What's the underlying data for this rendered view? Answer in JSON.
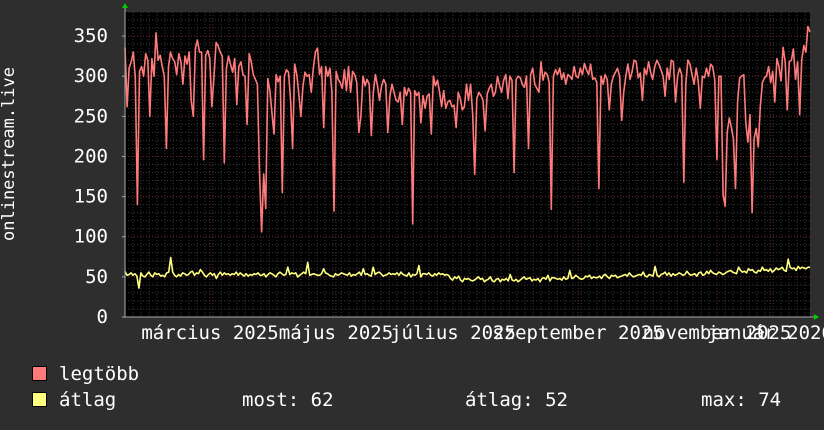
{
  "chart_data": {
    "type": "line",
    "ylabel": "onlinestream.live",
    "ylim": [
      0,
      380
    ],
    "yticks": [
      0,
      50,
      100,
      150,
      200,
      250,
      300,
      350
    ],
    "x_tick_labels": [
      "március 2025",
      "május 2025",
      "július 2025",
      "szeptember 2025",
      "november 2025",
      "január 2026"
    ],
    "grid": true,
    "series": [
      {
        "name": "legtöbb",
        "color": "#ff7b7b",
        "values": [
          336,
          262,
          310,
          318,
          330,
          298,
          140,
          306,
          312,
          300,
          328,
          320,
          250,
          322,
          300,
          354,
          320,
          326,
          312,
          300,
          210,
          312,
          330,
          322,
          318,
          302,
          328,
          318,
          290,
          325,
          315,
          330,
          270,
          250,
          335,
          345,
          330,
          330,
          196,
          326,
          332,
          322,
          262,
          300,
          342,
          338,
          330,
          325,
          192,
          310,
          325,
          315,
          305,
          322,
          265,
          312,
          318,
          302,
          300,
          240,
          328,
          318,
          302,
          296,
          290,
          180,
          106,
          178,
          135,
          297,
          282,
          255,
          228,
          302,
          293,
          300,
          155,
          300,
          308,
          305,
          270,
          210,
          315,
          302,
          278,
          250,
          288,
          305,
          300,
          302,
          280,
          310,
          330,
          335,
          302,
          312,
          236,
          312,
          300,
          310,
          280,
          132,
          306,
          296,
          292,
          285,
          308,
          282,
          312,
          280,
          306,
          302,
          292,
          230,
          250,
          300,
          288,
          296,
          290,
          226,
          280,
          302,
          288,
          270,
          288,
          296,
          290,
          230,
          275,
          290,
          280,
          270,
          268,
          280,
          240,
          286,
          276,
          285,
          280,
          116,
          282,
          276,
          280,
          242,
          276,
          260,
          275,
          278,
          228,
          300,
          288,
          295,
          280,
          262,
          282,
          260,
          268,
          270,
          262,
          264,
          236,
          280,
          272,
          258,
          262,
          290,
          270,
          290,
          252,
          178,
          272,
          280,
          276,
          270,
          232,
          278,
          285,
          290,
          275,
          280,
          300,
          288,
          280,
          295,
          302,
          272,
          300,
          295,
          180,
          296,
          300,
          298,
          290,
          286,
          300,
          210,
          302,
          310,
          290,
          285,
          280,
          318,
          295,
          305,
          302,
          292,
          134,
          300,
          308,
          302,
          310,
          296,
          304,
          290,
          302,
          300,
          296,
          312,
          300,
          298,
          310,
          302,
          316,
          308,
          302,
          315,
          296,
          298,
          292,
          160,
          300,
          290,
          302,
          296,
          258,
          290,
          300,
          305,
          310,
          300,
          245,
          280,
          300,
          315,
          296,
          305,
          320,
          318,
          298,
          304,
          270,
          310,
          302,
          318,
          305,
          296,
          312,
          320,
          315,
          308,
          300,
          275,
          310,
          296,
          320,
          318,
          268,
          300,
          310,
          302,
          168,
          290,
          320,
          315,
          302,
          290,
          310,
          294,
          260,
          300,
          298,
          310,
          300,
          315,
          312,
          295,
          196,
          300,
          300,
          152,
          138,
          230,
          248,
          236,
          222,
          160,
          268,
          298,
          300,
          302,
          242,
          218,
          252,
          130,
          222,
          235,
          212,
          262,
          292,
          298,
          300,
          312,
          292,
          306,
          268,
          322,
          312,
          294,
          336,
          318,
          258,
          318,
          320,
          334,
          296,
          318,
          252,
          320,
          338,
          330,
          362,
          355
        ]
      },
      {
        "name": "átlag",
        "color": "#ffff80",
        "values": [
          57,
          52,
          53,
          55,
          52,
          54,
          51,
          36,
          55,
          51,
          50,
          53,
          56,
          52,
          50,
          55,
          53,
          54,
          51,
          52,
          50,
          55,
          56,
          74,
          56,
          52,
          50,
          53,
          51,
          55,
          54,
          52,
          53,
          56,
          57,
          52,
          55,
          54,
          59,
          56,
          52,
          50,
          53,
          55,
          52,
          54,
          48,
          53,
          56,
          52,
          55,
          53,
          54,
          52,
          54,
          53,
          56,
          52,
          55,
          53,
          51,
          54,
          51,
          53,
          52,
          54,
          53,
          55,
          52,
          52,
          54,
          50,
          53,
          55,
          54,
          52,
          50,
          54,
          56,
          54,
          52,
          53,
          62,
          53,
          55,
          54,
          55,
          50,
          52,
          54,
          56,
          54,
          68,
          52,
          53,
          54,
          53,
          52,
          52,
          54,
          60,
          55,
          54,
          52,
          51,
          50,
          54,
          52,
          53,
          55,
          54,
          53,
          52,
          55,
          51,
          53,
          52,
          54,
          56,
          52,
          60,
          53,
          54,
          52,
          51,
          62,
          53,
          55,
          56,
          54,
          51,
          52,
          53,
          55,
          53,
          54,
          53,
          55,
          52,
          56,
          53,
          52,
          51,
          55,
          50,
          53,
          52,
          54,
          64,
          50,
          54,
          54,
          53,
          55,
          52,
          51,
          54,
          52,
          55,
          53,
          54,
          52,
          53,
          52,
          48,
          46,
          50,
          48,
          51,
          46,
          44,
          48,
          47,
          48,
          46,
          45,
          46,
          48,
          50,
          47,
          48,
          44,
          46,
          47,
          50,
          45,
          44,
          47,
          48,
          44,
          47,
          46,
          48,
          45,
          53,
          46,
          45,
          47,
          44,
          46,
          48,
          50,
          47,
          48,
          49,
          45,
          47,
          46,
          48,
          44,
          48,
          49,
          47,
          52,
          45,
          49,
          49,
          48,
          47,
          48,
          46,
          50,
          47,
          48,
          58,
          48,
          49,
          52,
          50,
          48,
          47,
          48,
          51,
          50,
          52,
          48,
          50,
          49,
          49,
          51,
          48,
          52,
          53,
          50,
          48,
          52,
          51,
          52,
          49,
          50,
          51,
          52,
          53,
          51,
          55,
          52,
          50,
          51,
          52,
          53,
          52,
          56,
          51,
          50,
          53,
          52,
          51,
          63,
          52,
          50,
          53,
          54,
          56,
          52,
          55,
          51,
          54,
          52,
          53,
          55,
          54,
          52,
          53,
          57,
          54,
          52,
          53,
          54,
          51,
          55,
          56,
          52,
          53,
          57,
          54,
          58,
          55,
          54,
          53,
          56,
          55,
          53,
          54,
          56,
          57,
          58,
          56,
          55,
          54,
          62,
          58,
          56,
          57,
          55,
          60,
          58,
          59,
          56,
          55,
          58,
          57,
          62,
          58,
          59,
          57,
          60,
          56,
          58,
          61,
          59,
          60,
          62,
          58,
          57,
          72,
          62,
          60,
          61,
          58,
          63,
          60,
          62,
          61,
          60,
          62,
          62
        ]
      }
    ]
  },
  "legend": {
    "max_label": "legtöbb",
    "avg_label": "átlag"
  },
  "stats": {
    "now": "most: 62",
    "avg": "átlag: 52",
    "max": "max: 74"
  }
}
